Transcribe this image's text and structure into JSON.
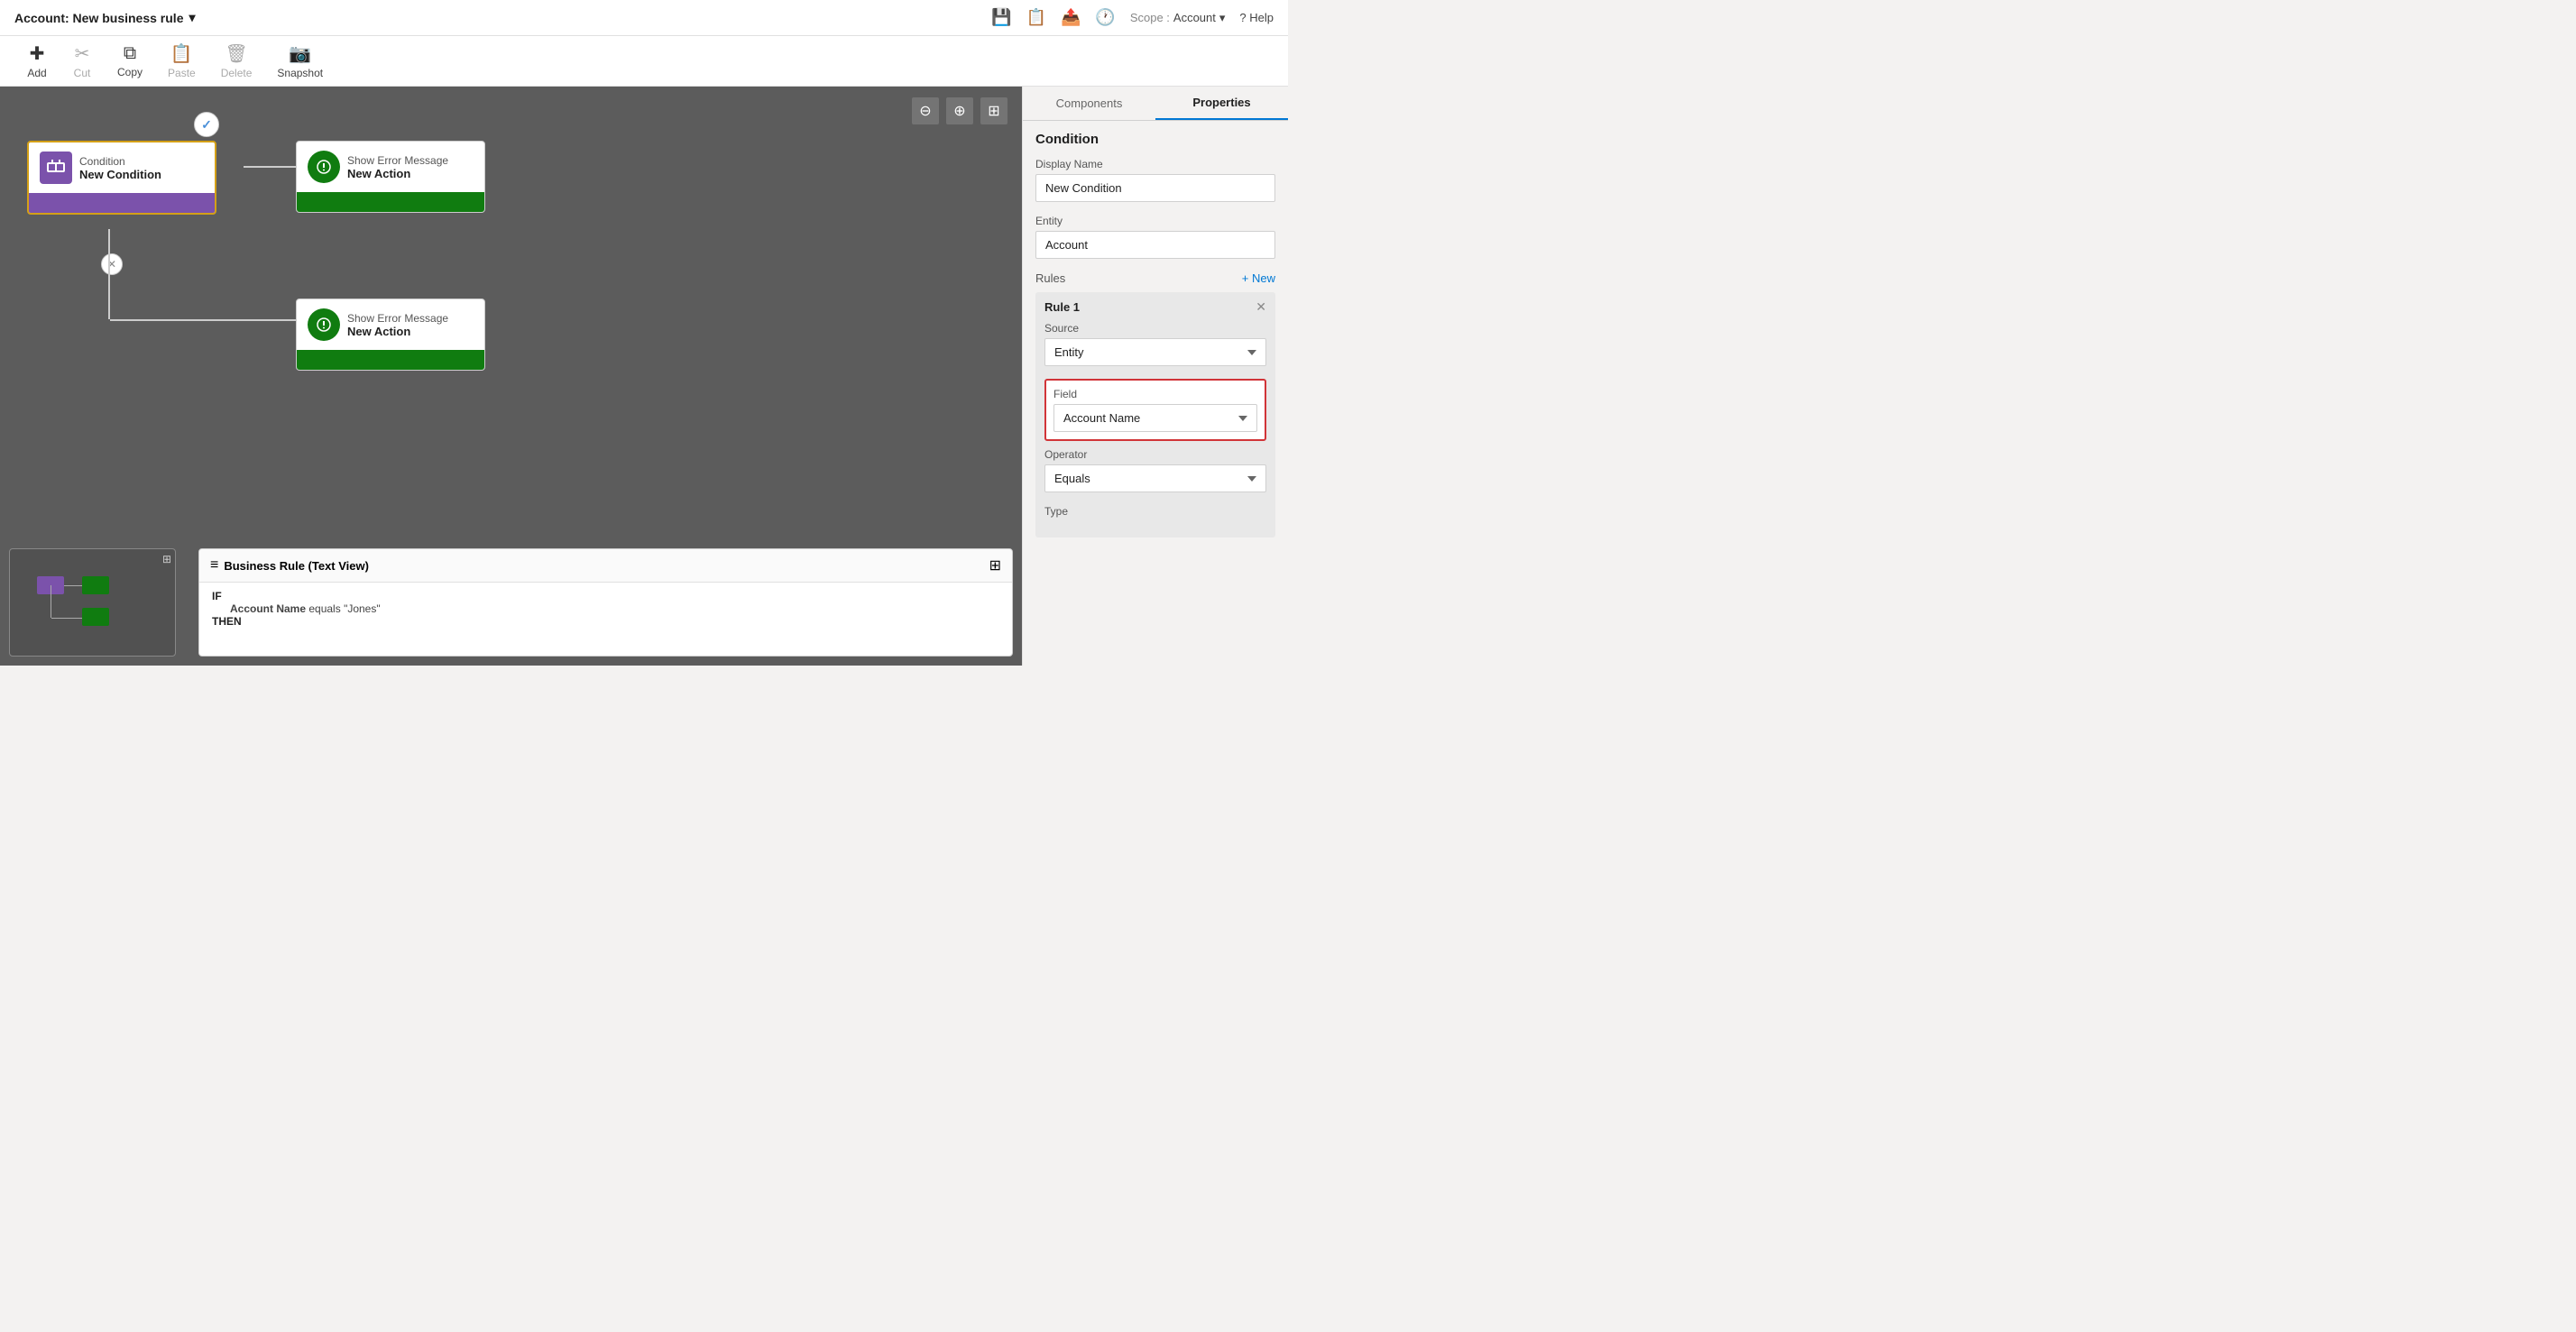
{
  "titleBar": {
    "title": "Account: New business rule",
    "dropdownIcon": "▾",
    "saveIcon": "💾",
    "checkIcon": "📋",
    "publishIcon": "📤",
    "historyIcon": "🕐",
    "scopeLabel": "Scope :",
    "scopeValue": "Account",
    "helpLabel": "? Help"
  },
  "toolbar": {
    "add": "Add",
    "cut": "Cut",
    "copy": "Copy",
    "paste": "Paste",
    "delete": "Delete",
    "snapshot": "Snapshot"
  },
  "canvas": {
    "zoomOut": "−",
    "zoomIn": "+",
    "fit": "⊞"
  },
  "conditionNode": {
    "type": "Condition",
    "name": "New Condition"
  },
  "actionNode1": {
    "type": "Show Error Message",
    "name": "New Action"
  },
  "actionNode2": {
    "type": "Show Error Message",
    "name": "New Action"
  },
  "textView": {
    "title": "Business Rule (Text View)",
    "expandIcon": "⊞",
    "listIcon": "≡",
    "if": "IF",
    "condition": "Account Name equals \"Jones\"",
    "then": "THEN"
  },
  "rightPanel": {
    "tabs": {
      "components": "Components",
      "properties": "Properties"
    },
    "activeTab": "Properties",
    "sectionTitle": "Condition",
    "displayNameLabel": "Display Name",
    "displayNameValue": "New Condition",
    "entityLabel": "Entity",
    "entityValue": "Account",
    "rulesLabel": "Rules",
    "rulesNewBtn": "+ New",
    "rule1Title": "Rule 1",
    "sourceLabel": "Source",
    "sourceValue": "Entity",
    "fieldLabel": "Field",
    "fieldValue": "Account Name",
    "operatorLabel": "Operator",
    "operatorValue": "Equals",
    "typeLabel": "Type"
  }
}
